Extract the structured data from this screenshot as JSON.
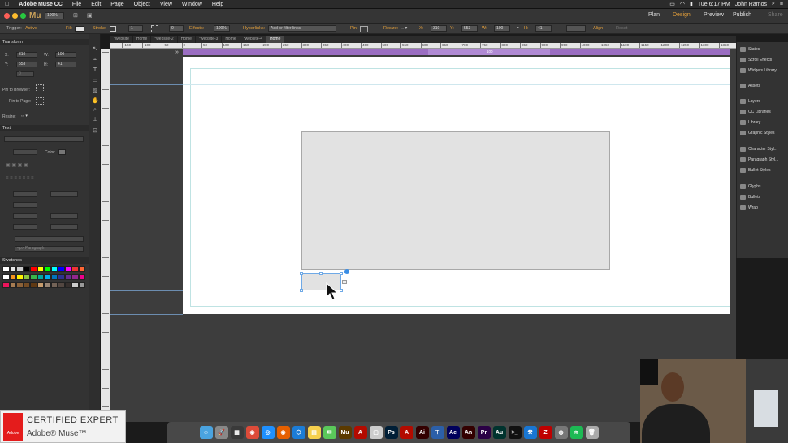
{
  "menubar": {
    "app_name": "Adobe Muse CC",
    "items": [
      "File",
      "Edit",
      "Page",
      "Object",
      "View",
      "Window",
      "Help"
    ],
    "clock": "Tue 6:17 PM",
    "user": "John Ramos"
  },
  "titlebar": {
    "logo": "Mu",
    "zoom": "100%",
    "modes": [
      "Plan",
      "Design",
      "Preview",
      "Publish",
      "Share"
    ],
    "active_mode": "Design"
  },
  "options_bar": {
    "trigger_label": "Trigger:",
    "trigger_value": "Active",
    "fill_label": "Fill:",
    "stroke_label": "Stroke:",
    "stroke_value": "1",
    "corner_value": "0",
    "effects_label": "Effects:",
    "opacity_value": "100%",
    "hyperlinks_label": "Hyperlinks:",
    "hyperlinks_placeholder": "Add or filter links",
    "pin_label": "Pin:",
    "resize_label": "Resize:",
    "x_label": "X:",
    "x_value": "310",
    "y_label": "Y:",
    "y_value": "553",
    "w_label": "W:",
    "w_value": "100",
    "h_label": "H:",
    "h_value": "41",
    "align_label": "Align",
    "reset_label": "Reset"
  },
  "transform_panel": {
    "title": "Transform",
    "x_label": "X:",
    "x_value": "310",
    "y_label": "Y:",
    "y_value": "553",
    "w_label": "W:",
    "w_value": "100",
    "h_label": "H:",
    "h_value": "41",
    "angle_value": "0",
    "pin_browser_label": "Pin to Browser:",
    "pin_page_label": "Pin to Page:",
    "resize_label": "Resize:"
  },
  "text_panel": {
    "title": "Text",
    "color_label": "Color:",
    "paragraph_placeholder": "<p> Paragraph"
  },
  "swatches_panel": {
    "title": "Swatches",
    "colors": [
      "#ffffff",
      "#e6e6e6",
      "#cccccc",
      "#000000",
      "#ff0000",
      "#ffff00",
      "#00ff00",
      "#00ffff",
      "#0000ff",
      "#ff00ff",
      "#ee3333",
      "#ff6633",
      "#ffffff",
      "#f7941d",
      "#fff200",
      "#8dc63f",
      "#39b54a",
      "#00a99d",
      "#00aeef",
      "#0072bc",
      "#2e3192",
      "#662d91",
      "#92278f",
      "#ec008c",
      "#ed145b",
      "#a67c52",
      "#8c6239",
      "#754c24",
      "#603913",
      "#c69c6d",
      "#998675",
      "#736357",
      "#534741",
      "#362f2d",
      "#cccccc",
      "#999999"
    ]
  },
  "document_tabs": [
    {
      "label": "*website"
    },
    {
      "label": "Home"
    },
    {
      "label": "*website-2"
    },
    {
      "label": "Home"
    },
    {
      "label": "*website-3"
    },
    {
      "label": "Home"
    },
    {
      "label": "*website-4"
    },
    {
      "label": "Home"
    }
  ],
  "active_tab_index": 7,
  "ruler_labels": [
    "-150",
    "-100",
    "-50",
    "0",
    "50",
    "100",
    "150",
    "200",
    "250",
    "300",
    "350",
    "400",
    "450",
    "500",
    "550",
    "600",
    "650",
    "700",
    "750",
    "800",
    "850",
    "900",
    "950",
    "1000",
    "1050",
    "1100",
    "1150",
    "1200",
    "1250",
    "1300",
    "1350",
    "1400"
  ],
  "breakpoint_label": "100",
  "right_panel": {
    "items": [
      {
        "label": "States",
        "icon": "states-icon"
      },
      {
        "label": "Scroll Effects",
        "icon": "scroll-effects-icon"
      },
      {
        "label": "Widgets Library",
        "icon": "widgets-icon"
      },
      {
        "label": "Assets",
        "icon": "assets-icon"
      },
      {
        "label": "Layers",
        "icon": "layers-icon"
      },
      {
        "label": "CC Libraries",
        "icon": "cc-libraries-icon"
      },
      {
        "label": "Library",
        "icon": "library-icon"
      },
      {
        "label": "Graphic Styles",
        "icon": "graphic-styles-icon"
      },
      {
        "label": "Character Styl...",
        "icon": "character-styles-icon"
      },
      {
        "label": "Paragraph Styl...",
        "icon": "paragraph-styles-icon"
      },
      {
        "label": "Bullet Styles",
        "icon": "bullet-styles-icon"
      },
      {
        "label": "Glyphs",
        "icon": "glyphs-icon"
      },
      {
        "label": "Bullets",
        "icon": "bullets-icon"
      },
      {
        "label": "Wrap",
        "icon": "wrap-icon"
      }
    ]
  },
  "dock_apps": [
    {
      "name": "finder",
      "color": "#4aa3df",
      "glyph": "☺"
    },
    {
      "name": "launchpad",
      "color": "#888888",
      "glyph": "🚀"
    },
    {
      "name": "mission-control",
      "color": "#3a3a3a",
      "glyph": "▦"
    },
    {
      "name": "chrome",
      "color": "#dd4b39",
      "glyph": "◉"
    },
    {
      "name": "safari",
      "color": "#1e90ff",
      "glyph": "◎"
    },
    {
      "name": "firefox",
      "color": "#e66000",
      "glyph": "◉"
    },
    {
      "name": "app-store",
      "color": "#1c7cd6",
      "glyph": "⬡"
    },
    {
      "name": "notes",
      "color": "#f6d04d",
      "glyph": "▤"
    },
    {
      "name": "messages",
      "color": "#5ac85a",
      "glyph": "✉"
    },
    {
      "name": "muse",
      "color": "#5b3a00",
      "glyph": "Mu"
    },
    {
      "name": "acrobat",
      "color": "#b30b00",
      "glyph": "A"
    },
    {
      "name": "preview",
      "color": "#cccccc",
      "glyph": "▢"
    },
    {
      "name": "photoshop",
      "color": "#001e36",
      "glyph": "Ps"
    },
    {
      "name": "acrobat-2",
      "color": "#b30b00",
      "glyph": "A"
    },
    {
      "name": "illustrator",
      "color": "#330000",
      "glyph": "Ai"
    },
    {
      "name": "keynote",
      "color": "#2c5fa8",
      "glyph": "⊤"
    },
    {
      "name": "after-effects",
      "color": "#00005b",
      "glyph": "Ae"
    },
    {
      "name": "animate",
      "color": "#330000",
      "glyph": "An"
    },
    {
      "name": "premiere",
      "color": "#2a0045",
      "glyph": "Pr"
    },
    {
      "name": "audition",
      "color": "#00332e",
      "glyph": "Au"
    },
    {
      "name": "terminal",
      "color": "#111111",
      "glyph": ">_"
    },
    {
      "name": "xcode",
      "color": "#1976d2",
      "glyph": "⚒"
    },
    {
      "name": "filezilla",
      "color": "#bf0000",
      "glyph": "Z"
    },
    {
      "name": "media",
      "color": "#777777",
      "glyph": "◍"
    },
    {
      "name": "spotify",
      "color": "#1db954",
      "glyph": "≋"
    },
    {
      "name": "trash",
      "color": "#aaaaaa",
      "glyph": "🗑"
    }
  ],
  "badge": {
    "line1": "CERTIFIED EXPERT",
    "line2": "Adobe® Muse™",
    "logo_text": "Adobe"
  }
}
